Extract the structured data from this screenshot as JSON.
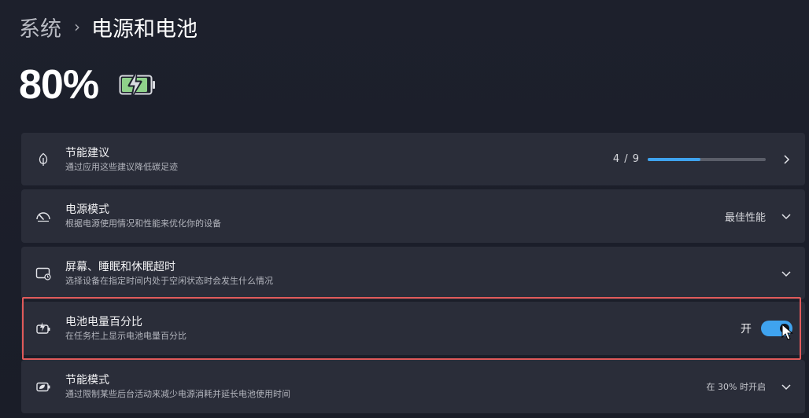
{
  "breadcrumb": {
    "parent": "系统",
    "separator": "›",
    "current": "电源和电池"
  },
  "battery": {
    "percentage_text": "80%",
    "charging_icon": "battery-charging-icon",
    "level": 0.8
  },
  "settings": {
    "energy_recommendations": {
      "title": "节能建议",
      "subtitle": "通过应用这些建议降低碳足迹",
      "progress_text": "4 / 9",
      "progress_fraction": 0.444,
      "icon": "leaf-icon"
    },
    "power_mode": {
      "title": "电源模式",
      "subtitle": "根据电源使用情况和性能来优化你的设备",
      "value": "最佳性能",
      "icon": "gauge-icon"
    },
    "screen_sleep": {
      "title": "屏幕、睡眠和休眠超时",
      "subtitle": "选择设备在指定时间内处于空闲状态时会发生什么情况",
      "icon": "screen-sleep-icon"
    },
    "battery_percentage": {
      "title": "电池电量百分比",
      "subtitle": "在任务栏上显示电池电量百分比",
      "toggle_label": "开",
      "toggle_on": true,
      "icon": "battery-percent-icon"
    },
    "energy_saver": {
      "title": "节能模式",
      "subtitle": "通过限制某些后台活动来减少电源消耗并延长电池使用时间",
      "value": "在 30% 时开启",
      "icon": "battery-saver-icon"
    }
  },
  "colors": {
    "accent": "#3fa3ef",
    "highlight": "#e05a5a",
    "battery_fill": "#8fd18a"
  }
}
